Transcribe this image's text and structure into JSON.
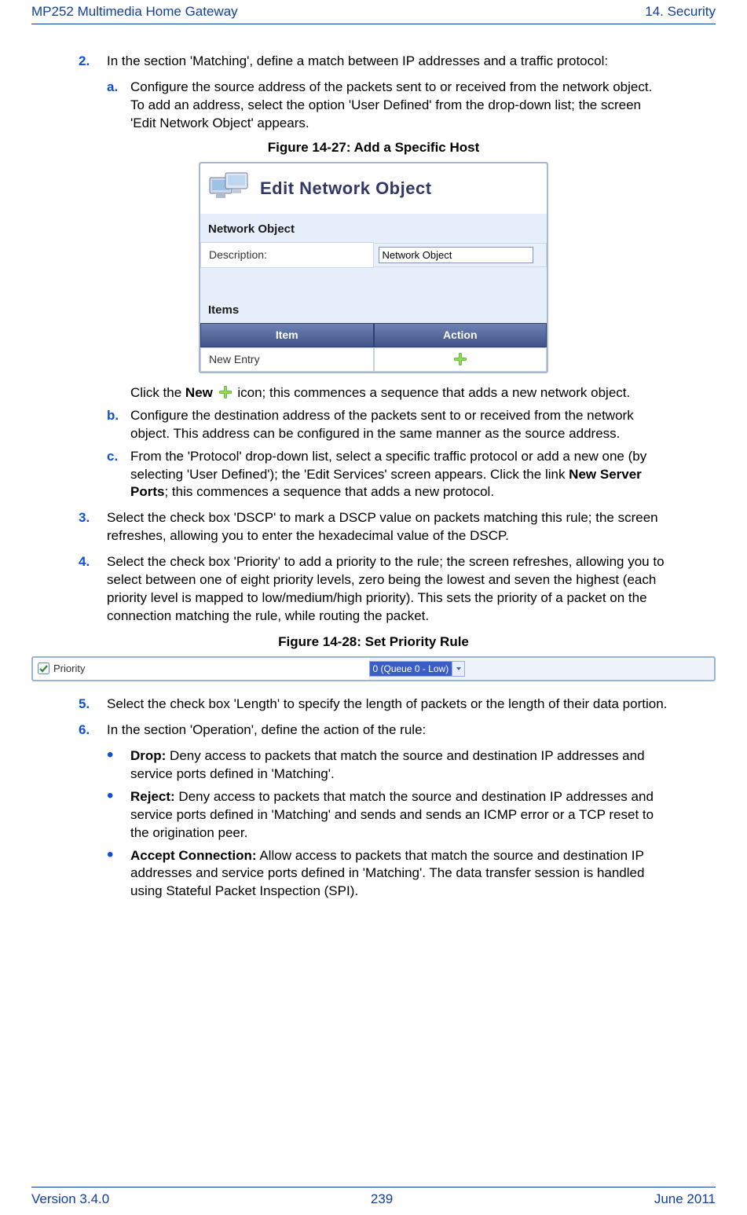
{
  "header": {
    "left": "MP252 Multimedia Home Gateway",
    "right": "14. Security"
  },
  "steps": {
    "s2": {
      "num": "2.",
      "text": "In the section 'Matching', define a match between IP addresses and a traffic protocol:",
      "a": {
        "letter": "a.",
        "text": "Configure the source address of the packets sent to or received from the network object. To add an address, select the option 'User Defined' from the drop-down list; the screen 'Edit Network Object' appears."
      },
      "fig_a": "Figure 14-27: Add a Specific Host",
      "a_cont_pre": "Click the ",
      "a_cont_bold": "New",
      "a_cont_post": " icon; this commences a sequence that adds a new network object.",
      "b": {
        "letter": "b.",
        "text": "Configure the destination address of the packets sent to or received from the network object. This address can be configured in the same manner as the source address."
      },
      "c": {
        "letter": "c.",
        "pre": "From the 'Protocol' drop-down list, select a specific traffic protocol or add a new one (by selecting 'User Defined'); the 'Edit Services' screen appears. Click the link ",
        "bold": "New Server Ports",
        "post": "; this commences a sequence that adds a new protocol."
      }
    },
    "s3": {
      "num": "3.",
      "text": "Select the check box 'DSCP' to mark a DSCP value on packets matching this rule; the screen refreshes, allowing you to enter the hexadecimal value of the DSCP."
    },
    "s4": {
      "num": "4.",
      "text": "Select the check box 'Priority' to add a priority to the rule; the screen refreshes, allowing you to select between one of eight priority levels, zero being the lowest and seven the highest (each priority level is mapped to low/medium/high priority). This sets the priority of a packet on the connection matching the rule, while routing the packet."
    },
    "fig_b": "Figure 14-28: Set Priority Rule",
    "s5": {
      "num": "5.",
      "text": "Select the check box 'Length' to specify the length of packets or the length of their data portion."
    },
    "s6": {
      "num": "6.",
      "text": "In the section 'Operation', define the action of the rule:",
      "drop": {
        "bold": "Drop:",
        "text": " Deny access to packets that match the source and destination IP addresses and service ports defined in 'Matching'."
      },
      "reject": {
        "bold": "Reject:",
        "text": " Deny access to packets that match the source and destination IP addresses and service ports defined in 'Matching' and sends and sends an ICMP error or a TCP reset to the origination peer."
      },
      "accept": {
        "bold": "Accept Connection:",
        "text": " Allow access to packets that match the source and destination IP addresses and service ports defined in 'Matching'. The data transfer session is handled using Stateful Packet Inspection (SPI)."
      }
    }
  },
  "net_obj": {
    "title": "Edit Network Object",
    "section1": "Network Object",
    "desc_label": "Description:",
    "desc_value": "Network Object",
    "section2": "Items",
    "col_item": "Item",
    "col_action": "Action",
    "row_new": "New Entry"
  },
  "priority": {
    "label": "Priority",
    "value": "0 (Queue 0 - Low)"
  },
  "footer": {
    "left": "Version 3.4.0",
    "center": "239",
    "right": "June 2011"
  }
}
